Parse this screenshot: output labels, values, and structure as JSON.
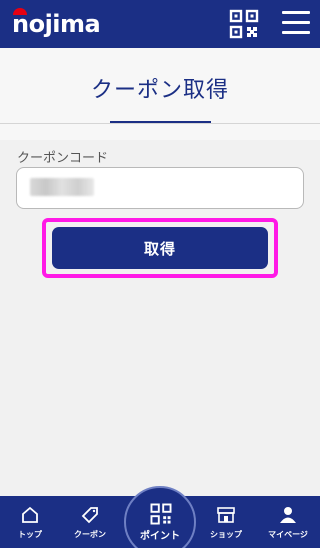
{
  "header": {
    "logo_text": "nojima",
    "qr_icon": "qr-code-icon",
    "menu_icon": "hamburger-menu-icon"
  },
  "page": {
    "title": "クーポン取得"
  },
  "form": {
    "code_label": "クーポンコード",
    "code_value": "",
    "submit_label": "取得"
  },
  "colors": {
    "brand": "#1b2f85",
    "highlight": "#ff19e6",
    "logo_accent": "#e60012"
  },
  "bottom_nav": {
    "items": [
      {
        "label": "トップ",
        "icon": "home-icon"
      },
      {
        "label": "クーポン",
        "icon": "coupon-tag-icon"
      },
      {
        "label": "ポイント",
        "icon": "qr-code-icon"
      },
      {
        "label": "ショップ",
        "icon": "shop-icon"
      },
      {
        "label": "マイページ",
        "icon": "person-icon"
      }
    ]
  }
}
